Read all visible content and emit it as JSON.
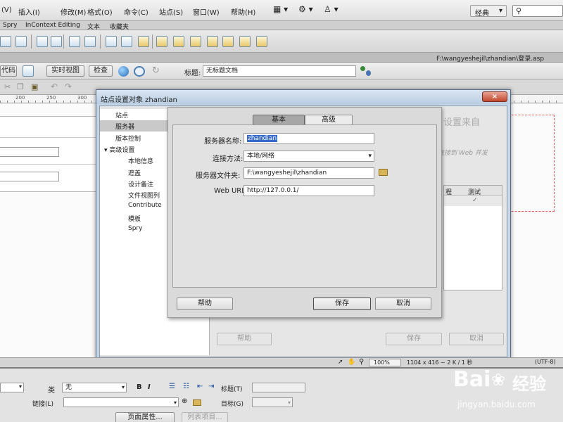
{
  "menubar": {
    "items": [
      "(V)",
      "插入(I)",
      "修改(M)",
      "格式(O)",
      "命令(C)",
      "站点(S)",
      "窗口(W)",
      "帮助(H)"
    ],
    "layout_label": "经典"
  },
  "insert_tabs": [
    "Spry",
    "InContext Editing",
    "文本",
    "收藏夹"
  ],
  "file_path": "F:\\wangyeshejil\\zhandian\\登录.asp",
  "doc_toolbar": {
    "code_label": "代码",
    "live_view_label": "实时视图",
    "inspect_label": "检查",
    "title_label": "标题:",
    "title_value": "无标题文档"
  },
  "ruler": {
    "ticks": [
      "200",
      "250",
      "300"
    ]
  },
  "dialog": {
    "title": "站点设置对象 zhandian",
    "close_glyph": "×",
    "categories": [
      {
        "label": "站点",
        "indent": 0,
        "selected": false
      },
      {
        "label": "服务器",
        "indent": 0,
        "selected": true
      },
      {
        "label": "版本控制",
        "indent": 0,
        "selected": false
      },
      {
        "label": "▾ 高级设置",
        "indent": 0,
        "selected": false
      },
      {
        "label": "本地信息",
        "indent": 1,
        "selected": false
      },
      {
        "label": "遮盖",
        "indent": 1,
        "selected": false
      },
      {
        "label": "设计备注",
        "indent": 1,
        "selected": false
      },
      {
        "label": "文件视图列",
        "indent": 1,
        "selected": false
      },
      {
        "label": "Contribute",
        "indent": 1,
        "selected": false
      },
      {
        "label": "模板",
        "indent": 1,
        "selected": false
      },
      {
        "label": "Spry",
        "indent": 1,
        "selected": false
      }
    ],
    "bg_text1": "设置来自",
    "bg_text2": "连接到 Web 并发",
    "bg_table": {
      "col1": "程",
      "col2": "测试",
      "check": "✓"
    },
    "bg_help_label": "帮助",
    "bg_save_label": "保存",
    "bg_cancel_label": "取消"
  },
  "server_dialog": {
    "tab_basic": "基本",
    "tab_advanced": "高级",
    "server_name_label": "服务器名称:",
    "server_name_value": "zhandian",
    "connect_label": "连接方法:",
    "connect_value": "本地/网络",
    "folder_label": "服务器文件夹:",
    "folder_value": "F:\\wangyeshejil\\zhandian",
    "url_label": "Web URL:",
    "url_value": "http://127.0.0.1/",
    "help_label": "帮助",
    "save_label": "保存",
    "cancel_label": "取消"
  },
  "status": {
    "zoom": "100%",
    "dims": "1104 x 416 ~ 2 K / 1 秒",
    "encoding": "(UTF-8)"
  },
  "properties": {
    "class_label": "类",
    "class_value": "无",
    "bold": "B",
    "italic": "I",
    "heading_label": "标题(T)",
    "link_label": "链接(L)",
    "target_label": "目标(G)",
    "page_props_label": "页面属性...",
    "list_item_label": "列表项目..."
  },
  "watermark": {
    "brand": "Bai",
    "brand2": "经验",
    "url": "jingyan.baidu.com"
  }
}
